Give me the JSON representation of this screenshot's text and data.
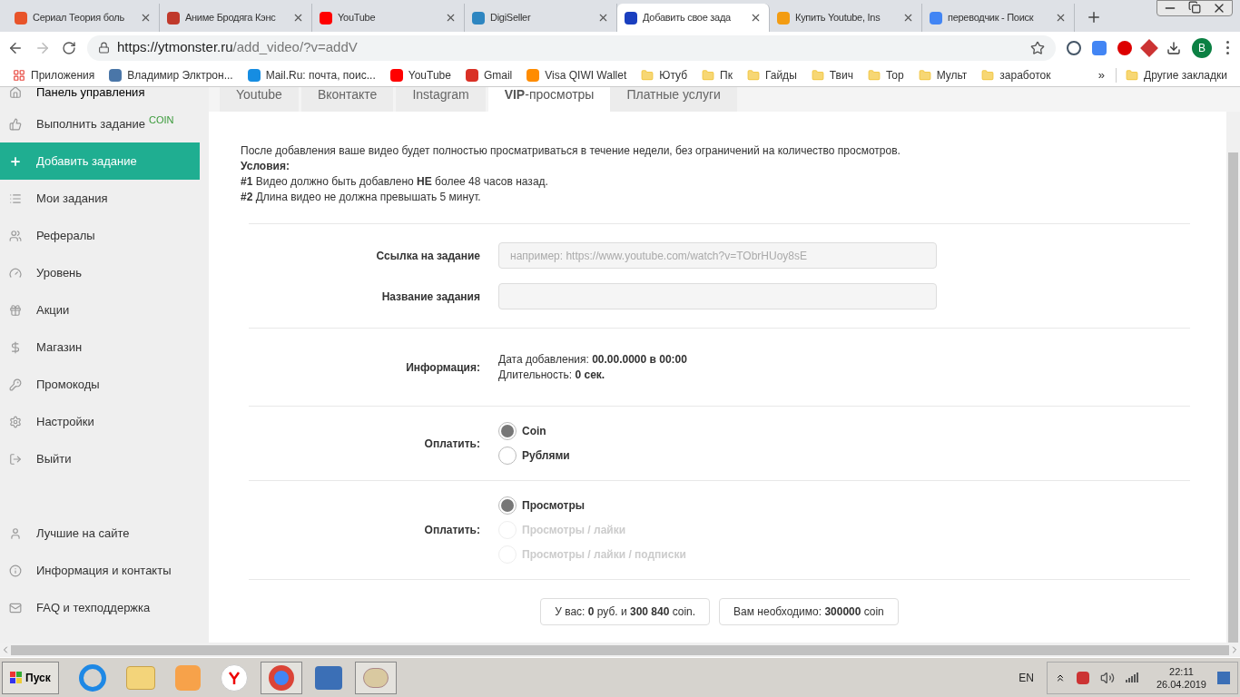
{
  "browser_tabs": [
    {
      "title": "Сериал Теория боль",
      "color": "#e8542a",
      "selected": false
    },
    {
      "title": "Аниме Бродяга Кэнс",
      "color": "#c0392b",
      "selected": false
    },
    {
      "title": "YouTube",
      "color": "#ff0000",
      "selected": false
    },
    {
      "title": "DigiSeller",
      "color": "#2e86c1",
      "selected": false
    },
    {
      "title": "Добавить свое зада",
      "color": "#1a3fbf",
      "selected": true
    },
    {
      "title": "Купить Youtube, Ins",
      "color": "#f39c12",
      "selected": false
    },
    {
      "title": "переводчик - Поиск",
      "color": "#4285f4",
      "selected": false
    }
  ],
  "address_bar": {
    "host": "https://ytmonster.ru",
    "path": "/add_video/?v=addV"
  },
  "profile": {
    "initial": "B"
  },
  "bookmarks": [
    {
      "kind": "apps",
      "label": "Приложения"
    },
    {
      "kind": "site",
      "label": "Владимир Элктрон...",
      "color": "#4a76a8"
    },
    {
      "kind": "site",
      "label": "Mail.Ru: почта, поис...",
      "color": "#168de2"
    },
    {
      "kind": "site",
      "label": "YouTube",
      "color": "#ff0000"
    },
    {
      "kind": "site",
      "label": "Gmail",
      "color": "#d93025"
    },
    {
      "kind": "site",
      "label": "Visa QIWI Wallet",
      "color": "#ff8c00"
    },
    {
      "kind": "folder",
      "label": "Ютуб"
    },
    {
      "kind": "folder",
      "label": "Пк"
    },
    {
      "kind": "folder",
      "label": "Гайды"
    },
    {
      "kind": "folder",
      "label": "Твич"
    },
    {
      "kind": "folder",
      "label": "Тор"
    },
    {
      "kind": "folder",
      "label": "Мульт"
    },
    {
      "kind": "folder",
      "label": "заработок"
    }
  ],
  "bookmarks_more": "»",
  "other_bookmarks": "Другие закладки",
  "sidebar": {
    "items": [
      {
        "label": "Панель управления",
        "selected": false
      },
      {
        "label": "Выполнить задание",
        "badge": "COIN",
        "selected": false
      },
      {
        "label": "Добавить задание",
        "selected": true
      },
      {
        "label": "Мои задания",
        "selected": false
      },
      {
        "label": "Рефералы",
        "selected": false
      },
      {
        "label": "Уровень",
        "selected": false
      },
      {
        "label": "Акции",
        "selected": false
      },
      {
        "label": "Магазин",
        "selected": false
      },
      {
        "label": "Промокоды",
        "selected": false
      },
      {
        "label": "Настройки",
        "selected": false
      },
      {
        "label": "Выйти",
        "selected": false
      }
    ],
    "footer_items": [
      {
        "label": "Лучшие на сайте"
      },
      {
        "label": "Информация и контакты"
      },
      {
        "label": "FAQ и техподдержка"
      }
    ]
  },
  "page_tabs": [
    {
      "label": "Youtube",
      "selected": false
    },
    {
      "label": "Вконтакте",
      "selected": false
    },
    {
      "label": "Instagram",
      "selected": false
    },
    {
      "label": "**VIP**-просмотры",
      "selected": true
    },
    {
      "label": "Платные услуги",
      "selected": false
    }
  ],
  "description": [
    "После добавления ваше видео будет полностью просматриваться в течение недели, без ограничений на количество просмотров.",
    "**Условия:**",
    "**#1** Видео должно быть добавлено **НЕ** более 48 часов назад.",
    "**#2** Длина видео не должна превышать 5 минут."
  ],
  "fields": [
    {
      "label": "Ссылка на задание",
      "placeholder": "например: https://www.youtube.com/watch?v=TObrHUoy8sE"
    },
    {
      "label": "Название задания"
    }
  ],
  "info": {
    "label": "Информация:",
    "lines": [
      "Дата добавления: **00.00.0000 в 00:00**",
      "Длительность: **0 сек.**"
    ]
  },
  "payment_groups": [
    {
      "label": "Оплатить:",
      "options": [
        {
          "label": "Coin",
          "selected": true,
          "disabled": false
        },
        {
          "label": "Рублями",
          "selected": false,
          "disabled": false
        }
      ]
    },
    {
      "label": "Оплатить:",
      "options": [
        {
          "label": "Просмотры",
          "selected": true,
          "disabled": false
        },
        {
          "label": "Просмотры / лайки",
          "selected": false,
          "disabled": true
        },
        {
          "label": "Просмотры / лайки / подписки",
          "selected": false,
          "disabled": true
        }
      ]
    }
  ],
  "balance": [
    "У вас: **0** руб. и **300 840** coin.",
    "Вам необходимо: **300000** coin"
  ],
  "taskbar": {
    "start": "Пуск",
    "language": "EN",
    "time": "22:11",
    "date": "26.04.2019"
  }
}
